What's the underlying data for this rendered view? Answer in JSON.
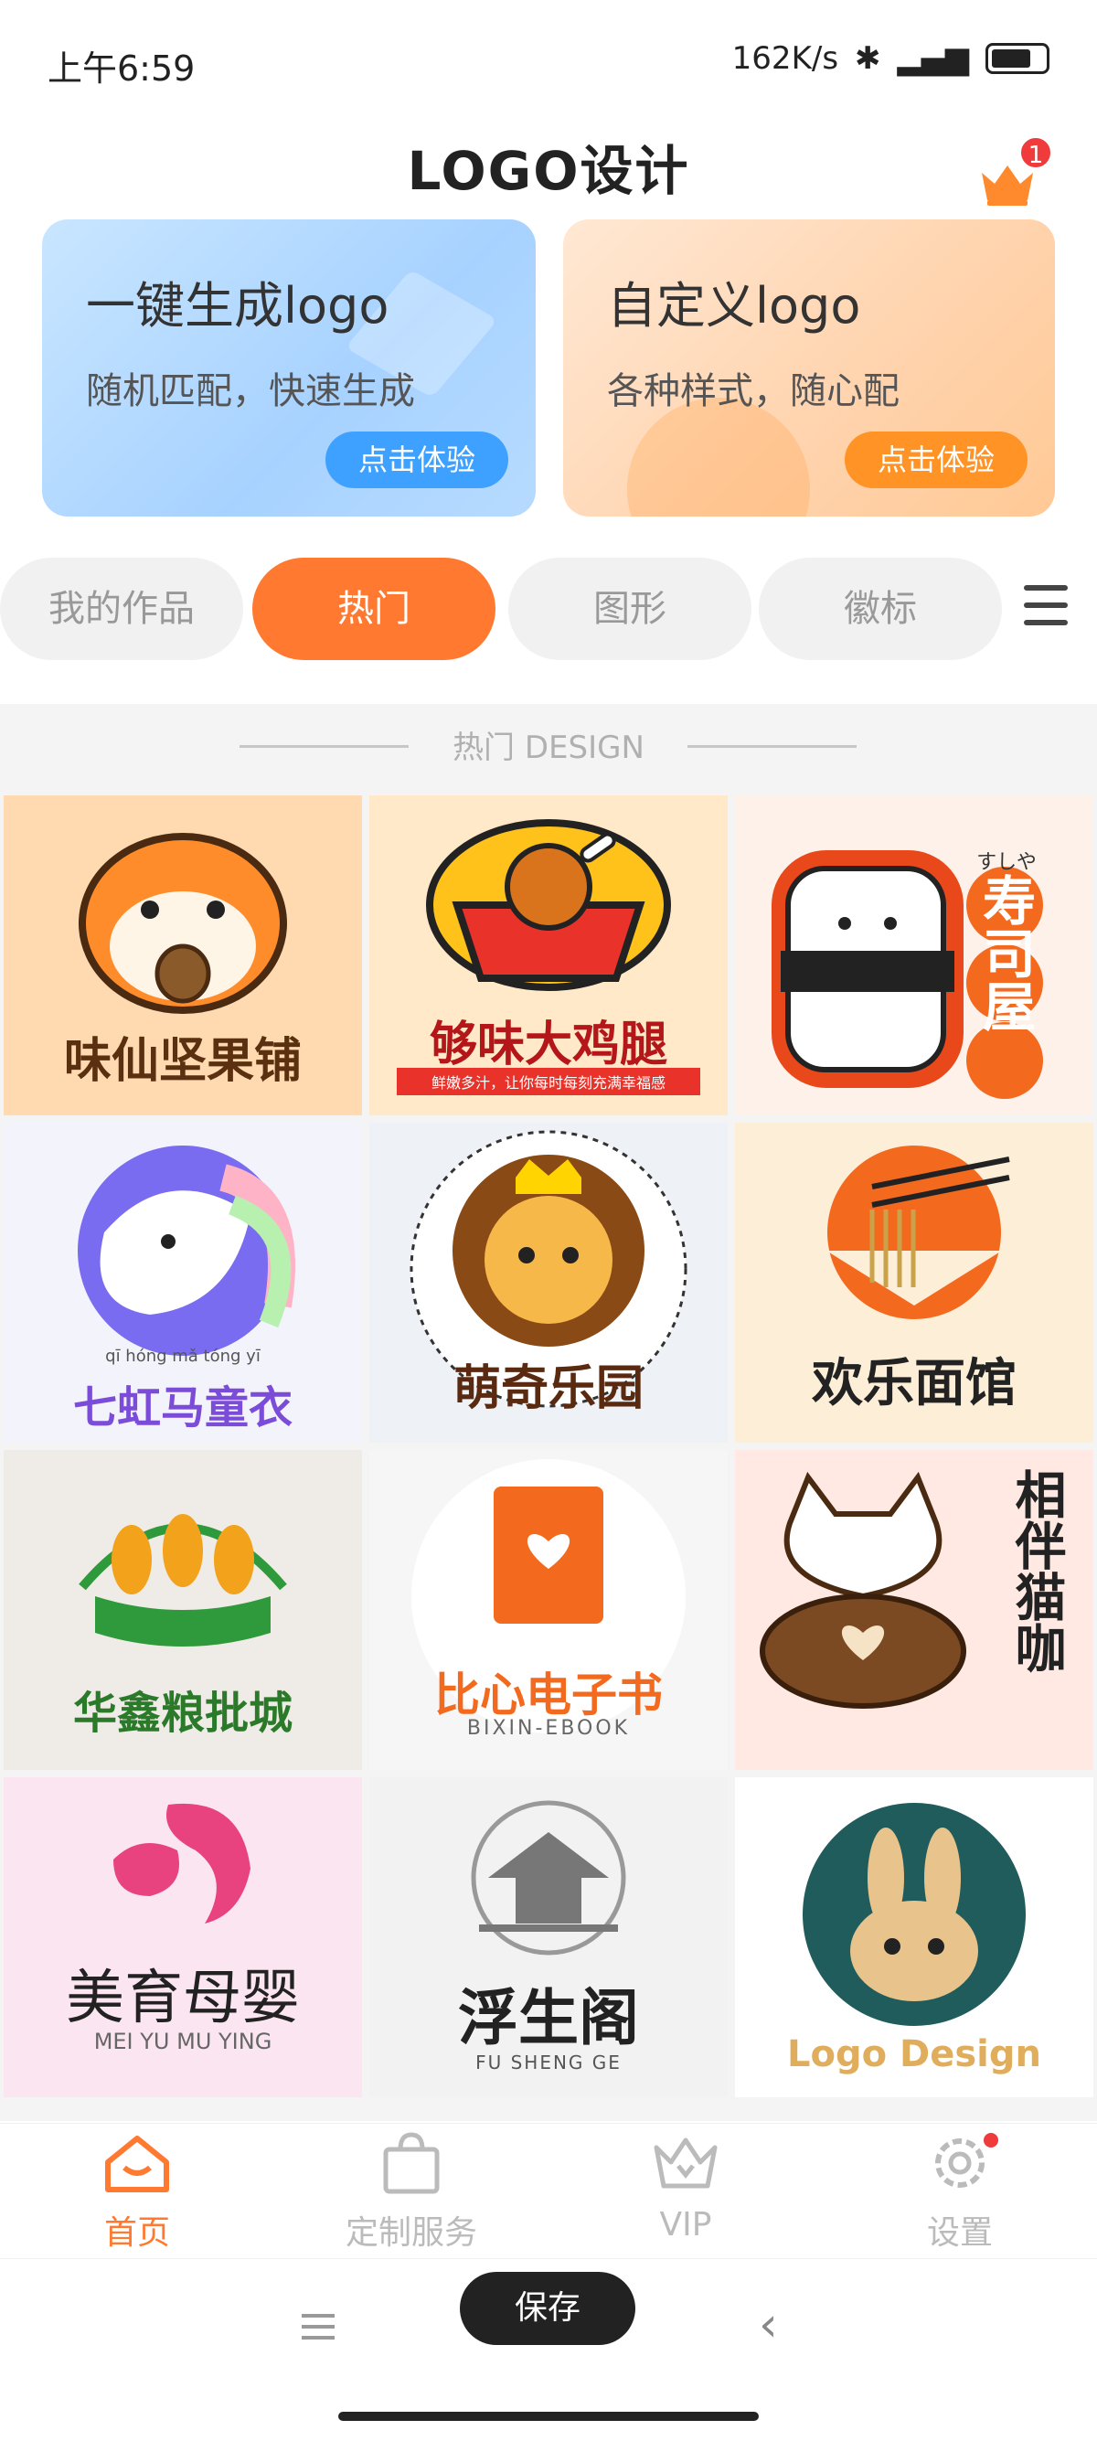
{
  "status_bar": {
    "time": "上午6:59",
    "network_speed": "162K/s",
    "battery": "68"
  },
  "header": {
    "title": "LOGO设计",
    "vip_badge_count": "1"
  },
  "banners": [
    {
      "title": "一键生成logo",
      "subtitle": "随机匹配，快速生成",
      "button": "点击体验",
      "accent": "#3fa1ff"
    },
    {
      "title": "自定义logo",
      "subtitle": "各种样式，随心配",
      "button": "点击体验",
      "accent": "#ff9326"
    }
  ],
  "tabs": [
    {
      "label": "我的作品",
      "active": false
    },
    {
      "label": "热门",
      "active": true
    },
    {
      "label": "图形",
      "active": false
    },
    {
      "label": "徽标",
      "active": false
    }
  ],
  "section": {
    "heading": "热门 DESIGN"
  },
  "logos": [
    {
      "name": "味仙坚果铺",
      "icon": "hamster-icon"
    },
    {
      "name": "够味大鸡腿",
      "tagline": "鲜嫩多汁，让你每时每刻充满幸福感",
      "icon": "chicken-leg-icon"
    },
    {
      "name": "寿司屋",
      "tagline": "すしや",
      "icon": "sushi-icon"
    },
    {
      "name": "七虹马童衣",
      "tagline": "qī hóng mǎ tóng yī",
      "icon": "unicorn-icon"
    },
    {
      "name": "萌奇乐园",
      "icon": "lion-icon"
    },
    {
      "name": "欢乐面馆",
      "icon": "noodles-icon"
    },
    {
      "name": "华鑫粮批城",
      "icon": "wheat-icon"
    },
    {
      "name": "比心电子书",
      "tagline": "BIXIN-EBOOK",
      "icon": "book-heart-icon"
    },
    {
      "name": "相伴猫咖",
      "icon": "cat-coffee-icon"
    },
    {
      "name": "美育母婴",
      "tagline": "MEI   YU   MU   YING",
      "icon": "mother-baby-icon"
    },
    {
      "name": "浮生阁",
      "tagline": "FU   SHENG   GE",
      "icon": "pavilion-icon"
    },
    {
      "name": "Logo Design",
      "icon": "rabbit-icon"
    }
  ],
  "bottom_nav": [
    {
      "label": "首页",
      "icon": "home-icon",
      "active": true
    },
    {
      "label": "定制服务",
      "icon": "shopping-bag-icon",
      "active": false
    },
    {
      "label": "VIP",
      "icon": "crown-icon",
      "active": false
    },
    {
      "label": "设置",
      "icon": "gear-icon",
      "active": false
    }
  ],
  "system_bar": {
    "save_label": "保存"
  }
}
